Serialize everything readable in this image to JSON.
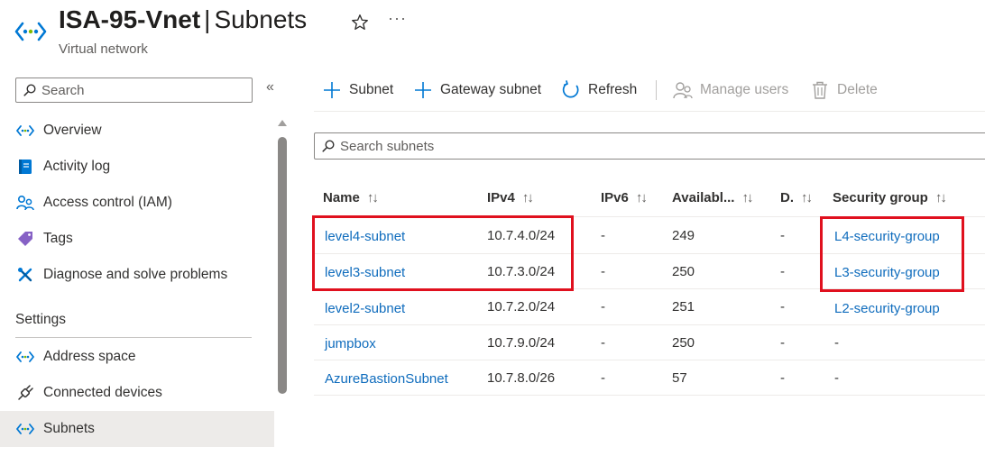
{
  "header": {
    "resource_name": "ISA-95-Vnet",
    "separator": "|",
    "page_name": "Subnets",
    "subtitle": "Virtual network",
    "more_label": "···"
  },
  "sidebar": {
    "search_placeholder": "Search",
    "collapse_label": "«",
    "items": [
      {
        "label": "Overview",
        "icon": "vnet-icon"
      },
      {
        "label": "Activity log",
        "icon": "activity-log-icon"
      },
      {
        "label": "Access control (IAM)",
        "icon": "iam-icon"
      },
      {
        "label": "Tags",
        "icon": "tag-icon"
      },
      {
        "label": "Diagnose and solve problems",
        "icon": "wrench-icon"
      }
    ],
    "section_title": "Settings",
    "settings_items": [
      {
        "label": "Address space",
        "icon": "vnet-icon"
      },
      {
        "label": "Connected devices",
        "icon": "plug-icon"
      },
      {
        "label": "Subnets",
        "icon": "vnet-icon",
        "active": true
      }
    ]
  },
  "toolbar": {
    "add_subnet": "Subnet",
    "gateway_subnet": "Gateway subnet",
    "refresh": "Refresh",
    "manage_users": "Manage users",
    "delete": "Delete"
  },
  "filter": {
    "placeholder": "Search subnets"
  },
  "table": {
    "sort_glyph": "↑↓",
    "columns": [
      "Name",
      "IPv4",
      "IPv6",
      "Availabl...",
      "D.",
      "Security group"
    ],
    "rows": [
      {
        "name": "level4-subnet",
        "ipv4": "10.7.4.0/24",
        "ipv6": "-",
        "available": "249",
        "delegated": "-",
        "security_group": "L4-security-group"
      },
      {
        "name": "level3-subnet",
        "ipv4": "10.7.3.0/24",
        "ipv6": "-",
        "available": "250",
        "delegated": "-",
        "security_group": "L3-security-group"
      },
      {
        "name": "level2-subnet",
        "ipv4": "10.7.2.0/24",
        "ipv6": "-",
        "available": "251",
        "delegated": "-",
        "security_group": "L2-security-group"
      },
      {
        "name": "jumpbox",
        "ipv4": "10.7.9.0/24",
        "ipv6": "-",
        "available": "250",
        "delegated": "-",
        "security_group": "-"
      },
      {
        "name": "AzureBastionSubnet",
        "ipv4": "10.7.8.0/26",
        "ipv6": "-",
        "available": "57",
        "delegated": "-",
        "security_group": "-"
      }
    ]
  },
  "colors": {
    "link": "#0f6cbd",
    "highlight": "#e0101e",
    "active_nav": "#edebe9",
    "azure_blue": "#0078d4"
  }
}
